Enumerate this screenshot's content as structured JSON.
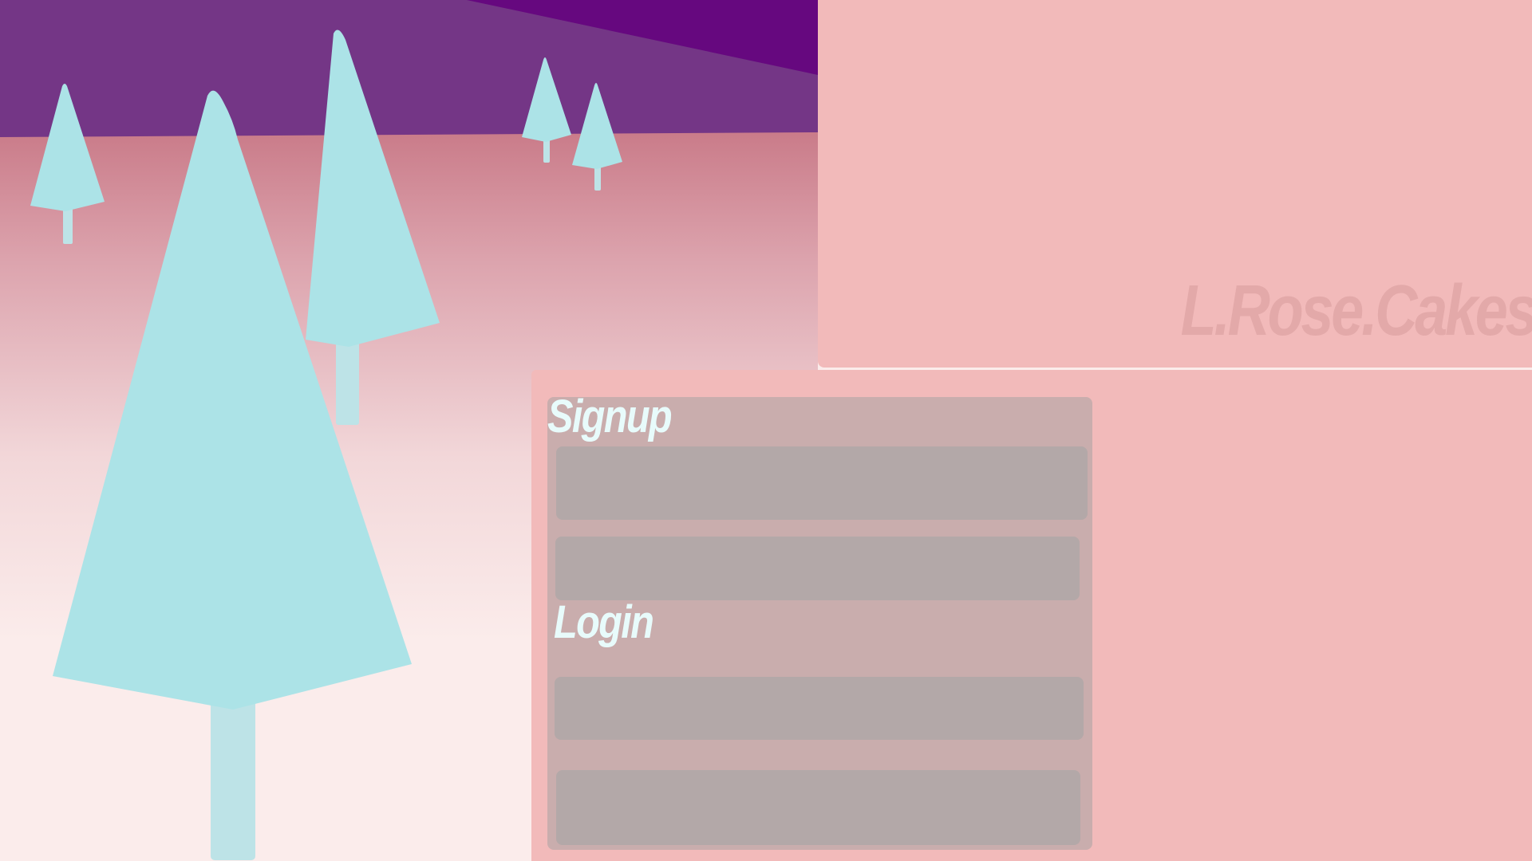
{
  "brand": {
    "logo_text": "L.Rose.Cakes"
  },
  "signup": {
    "heading": "Signup",
    "field_1": {
      "value": "",
      "placeholder": ""
    },
    "field_2": {
      "value": "",
      "placeholder": ""
    }
  },
  "login": {
    "heading": "Login",
    "field_1": {
      "value": "",
      "placeholder": ""
    },
    "field_2": {
      "value": "",
      "placeholder": ""
    }
  },
  "colors": {
    "sky_dark": "#66087f",
    "sky": "#743686",
    "horizon": "#c97a88",
    "snow": "#fbeceb",
    "tree": "#ace3e7",
    "trunk": "#bde3e7",
    "panel": "#f2baba",
    "card": "#c9adad",
    "field": "#b3a8a8",
    "heading": "#e8fbfb",
    "logo": "#e3a9a9"
  }
}
